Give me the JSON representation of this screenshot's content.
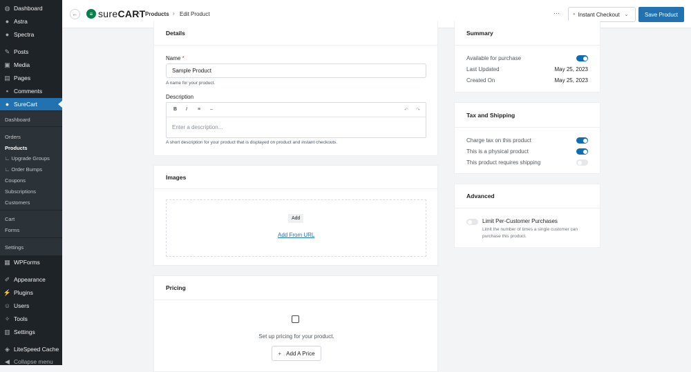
{
  "sidebar": {
    "items": [
      {
        "label": "Dashboard",
        "icon": "dashboard-icon"
      },
      {
        "label": "Astra",
        "icon": "astra-icon"
      },
      {
        "label": "Spectra",
        "icon": "spectra-icon"
      },
      {
        "label": "Posts",
        "icon": "pin-icon"
      },
      {
        "label": "Media",
        "icon": "media-icon"
      },
      {
        "label": "Pages",
        "icon": "pages-icon"
      },
      {
        "label": "Comments",
        "icon": "comment-icon"
      },
      {
        "label": "SureCart",
        "icon": "surecart-icon"
      }
    ],
    "submenu": [
      "Dashboard",
      "Orders",
      "Products",
      "∟ Upgrade Groups",
      "∟ Order Bumps",
      "Coupons",
      "Subscriptions",
      "Customers",
      "Cart",
      "Forms",
      "Settings"
    ],
    "bottom_items": [
      {
        "label": "WPForms",
        "icon": "wpforms-icon"
      },
      {
        "label": "Appearance",
        "icon": "brush-icon"
      },
      {
        "label": "Plugins",
        "icon": "plugin-icon"
      },
      {
        "label": "Users",
        "icon": "users-icon"
      },
      {
        "label": "Tools",
        "icon": "wrench-icon"
      },
      {
        "label": "Settings",
        "icon": "settings-icon"
      },
      {
        "label": "LiteSpeed Cache",
        "icon": "litespeed-icon"
      },
      {
        "label": "Collapse menu",
        "icon": "collapse-icon"
      }
    ]
  },
  "header": {
    "brand_light": "sure",
    "brand_bold": "CART",
    "breadcrumb": [
      "Products",
      "Edit Product"
    ],
    "more": "···",
    "checkout_select": "Instant Checkout",
    "save_label": "Save Product",
    "accent": "#2271b1"
  },
  "details": {
    "title": "Details",
    "name_label": "Name",
    "required_mark": "*",
    "name_value": "Sample Product",
    "name_help": "A name for your product.",
    "desc_label": "Description",
    "toolbar": [
      "B",
      "I",
      "≡",
      "–",
      "↶",
      "↷"
    ],
    "desc_placeholder": "Enter a description...",
    "desc_help": "A short description for your product that is displayed on product and instant checkouts."
  },
  "images": {
    "title": "Images",
    "add": "Add",
    "add_url": "Add From URL"
  },
  "pricing": {
    "title": "Pricing",
    "empty": "Set up pricing for your product.",
    "add_price": "Add A Price",
    "plus": "+"
  },
  "summary": {
    "title": "Summary",
    "available_label": "Available for purchase",
    "available": true,
    "updated_label": "Last Updated",
    "updated": "May 25, 2023",
    "created_label": "Created On",
    "created": "May 25, 2023"
  },
  "tax": {
    "title": "Tax and Shipping",
    "rows": [
      {
        "label": "Charge tax on this product",
        "on": true
      },
      {
        "label": "This is a physical product",
        "on": true
      },
      {
        "label": "This product requires shipping",
        "on": false
      }
    ]
  },
  "advanced": {
    "title": "Advanced",
    "limit_label": "Limit Per-Customer Purchases",
    "limit_on": false,
    "limit_help": "Limit the number of times a single customer can purchase this product."
  }
}
